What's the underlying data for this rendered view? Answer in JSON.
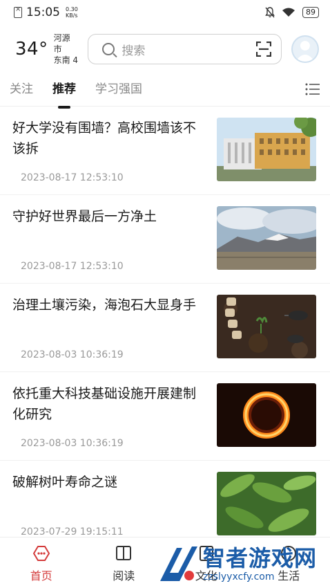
{
  "status_bar": {
    "time": "15:05",
    "speed_value": "0.30",
    "speed_unit": "KB/s",
    "battery": "89"
  },
  "header": {
    "temperature": "34°",
    "city": "河源市",
    "wind": "东南 4",
    "search_placeholder": "搜索"
  },
  "tabs": [
    {
      "label": "关注",
      "active": false
    },
    {
      "label": "推荐",
      "active": true
    },
    {
      "label": "学习强国",
      "active": false
    }
  ],
  "feed": [
    {
      "title": "好大学没有围墙？高校围墙该不该拆",
      "time": "2023-08-17 12:53:10",
      "image": "campus-building"
    },
    {
      "title": "守护好世界最后一方净土",
      "time": "2023-08-17 12:53:10",
      "image": "mountain-landscape"
    },
    {
      "title": "治理土壤污染，海泡石大显身手",
      "time": "2023-08-03 10:36:19",
      "image": "soil-gardening"
    },
    {
      "title": "依托重大科技基础设施开展建制化研究",
      "time": "2023-08-03 10:36:19",
      "image": "solar-ring"
    },
    {
      "title": "破解树叶寿命之谜",
      "time": "2023-07-29 19:15:11",
      "image": "green-leaves"
    }
  ],
  "bottom_nav": [
    {
      "label": "首页",
      "icon": "home-icon",
      "active": true
    },
    {
      "label": "阅读",
      "icon": "book-icon",
      "active": false
    },
    {
      "label": "文化",
      "icon": "culture-icon",
      "active": false
    },
    {
      "label": "生活",
      "icon": "life-icon",
      "active": false
    }
  ],
  "watermark": {
    "title": "智者游戏网",
    "url": "zzslyyxcfy.com"
  },
  "colors": {
    "accent": "#d43b3b",
    "watermark": "#1b5ca8"
  }
}
